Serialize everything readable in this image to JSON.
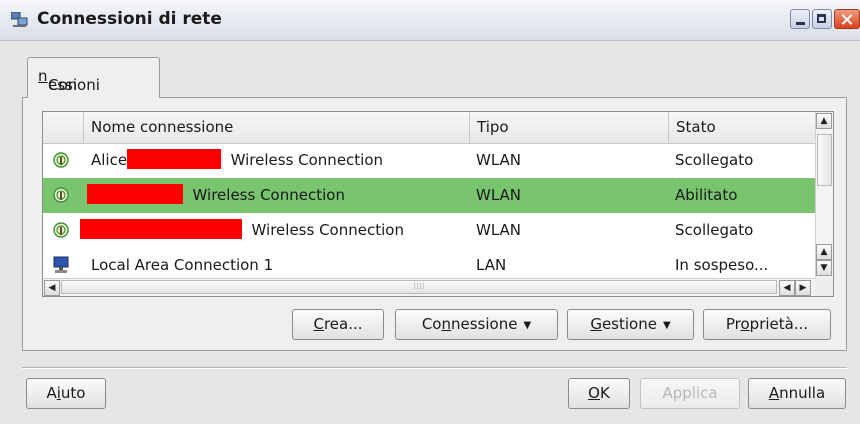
{
  "window": {
    "title": "Connessioni di rete"
  },
  "tabs": [
    {
      "label_pre": "Con",
      "label_accel": "n",
      "label_post": "essioni"
    }
  ],
  "table": {
    "columns": [
      "Nome connessione",
      "Tipo",
      "Stato"
    ],
    "rows": [
      {
        "icon": "wireless-icon",
        "name_prefix": "Alice",
        "name_suffix": "Wireless Connection",
        "type": "WLAN",
        "state": "Scollegato",
        "redacted": true
      },
      {
        "icon": "wireless-icon",
        "name_prefix": "",
        "name_suffix": "Wireless Connection",
        "type": "WLAN",
        "state": "Abilitato",
        "redacted": true,
        "selected": true
      },
      {
        "icon": "wireless-icon",
        "name_prefix": "",
        "name_suffix": "Wireless Connection",
        "type": "WLAN",
        "state": "Scollegato",
        "redacted": true
      },
      {
        "icon": "lan-computer-icon",
        "name_prefix": "Local Area Connection 1",
        "name_suffix": "",
        "type": "LAN",
        "state": "In sospeso...",
        "redacted": false
      }
    ]
  },
  "actions": {
    "create": {
      "accel": "C",
      "rest": "rea..."
    },
    "connection": {
      "pre": "Co",
      "accel": "n",
      "post": "nessione"
    },
    "manage": {
      "accel": "G",
      "rest": "estione"
    },
    "properties": {
      "pre": "Pr",
      "accel": "o",
      "post": "prietà..."
    }
  },
  "footer": {
    "help": {
      "pre": "A",
      "accel": "i",
      "post": "uto"
    },
    "ok": {
      "accel": "O",
      "rest": "K"
    },
    "apply": "Applica",
    "cancel": {
      "accel": "A",
      "rest": "nnulla"
    }
  },
  "colors": {
    "selection": "#79c46e",
    "redaction": "#ff0000",
    "close_button": "#d8431e"
  }
}
